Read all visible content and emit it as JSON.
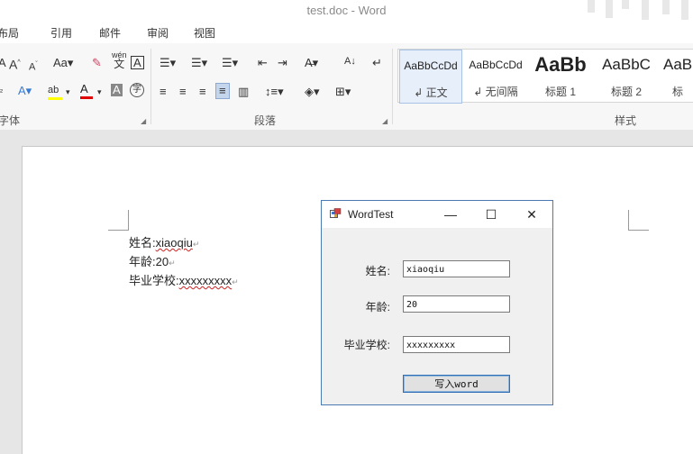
{
  "window": {
    "title": "test.doc - Word"
  },
  "ribbon_tabs": [
    "布局",
    "引用",
    "邮件",
    "审阅",
    "视图"
  ],
  "ribbon": {
    "font_group_label": "字体",
    "paragraph_group_label": "段落",
    "styles_group_label": "样式",
    "change_case_label": "Aa",
    "phonetic_top": "wén",
    "phonetic_bottom": "文",
    "styles": [
      {
        "sample": "AaBbCcDd",
        "name": "↲ 正文",
        "selected": true
      },
      {
        "sample": "AaBbCcDd",
        "name": "↲ 无间隔",
        "selected": false
      },
      {
        "sample": "AaBb",
        "name": "标题 1",
        "selected": false
      },
      {
        "sample": "AaBbC",
        "name": "标题 2",
        "selected": false
      },
      {
        "sample": "AaBl",
        "name": "标",
        "selected": false
      }
    ]
  },
  "document": {
    "lines": [
      {
        "label": "姓名:",
        "value": "xiaoqiu"
      },
      {
        "label": "年龄:",
        "value": "20"
      },
      {
        "label": "毕业学校:",
        "value": "xxxxxxxxx"
      }
    ],
    "para_mark": "↵"
  },
  "dialog": {
    "title": "WordTest",
    "controls": {
      "minimize": "—",
      "maximize": "☐",
      "close": "✕"
    },
    "fields": [
      {
        "label": "姓名:",
        "value": "xiaoqiu"
      },
      {
        "label": "年龄:",
        "value": "20"
      },
      {
        "label": "毕业学校:",
        "value": "xxxxxxxxx"
      }
    ],
    "submit_label": "写入word"
  },
  "colors": {
    "accent": "#2b579a",
    "highlight": "#ffff00",
    "font_color_red": "#e00000",
    "dialog_border": "#4a7bb0"
  }
}
